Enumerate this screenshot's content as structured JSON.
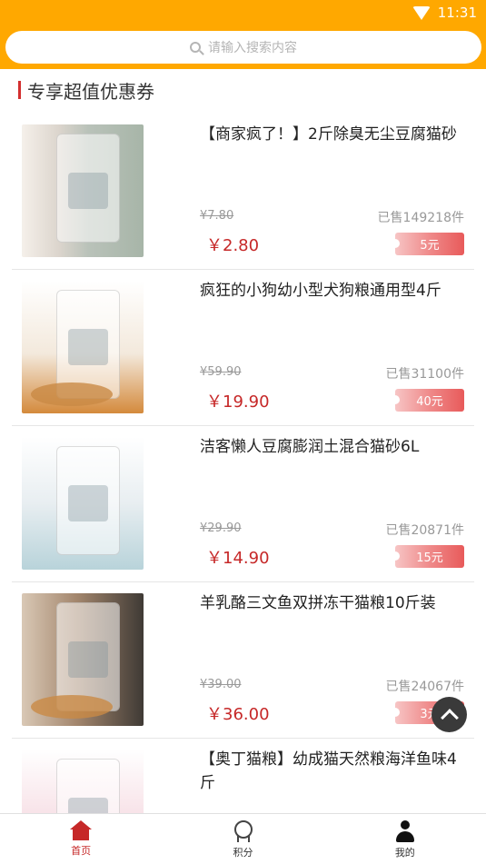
{
  "status_bar": {
    "time": "11:31"
  },
  "search": {
    "placeholder": "请输入搜索内容"
  },
  "section": {
    "title": "专享超值优惠券"
  },
  "products": [
    {
      "name": "【商家疯了！】2斤除臭无尘豆腐猫砂",
      "original_price": "¥7.80",
      "sold": "已售149218件",
      "price": "￥2.80",
      "coupon": "5元"
    },
    {
      "name": "疯狂的小狗幼小型犬狗粮通用型4斤",
      "original_price": "¥59.90",
      "sold": "已售31100件",
      "price": "￥19.90",
      "coupon": "40元"
    },
    {
      "name": "洁客懒人豆腐膨润土混合猫砂6L",
      "original_price": "¥29.90",
      "sold": "已售20871件",
      "price": "￥14.90",
      "coupon": "15元"
    },
    {
      "name": "羊乳酪三文鱼双拼冻干猫粮10斤装",
      "original_price": "¥39.00",
      "sold": "已售24067件",
      "price": "￥36.00",
      "coupon": "3元"
    },
    {
      "name": "【奥丁猫粮】幼成猫天然粮海洋鱼味4斤",
      "original_price": "",
      "sold": "",
      "price": "",
      "coupon": ""
    }
  ],
  "tabbar": {
    "home": "首页",
    "points": "积分",
    "mine": "我的"
  },
  "colors": {
    "header": "#ffa800",
    "accent": "#c62828",
    "coupon_start": "#f7c5c5",
    "coupon_end": "#e85a5a"
  },
  "icons": {
    "search": "search-icon",
    "wifi": "wifi-icon",
    "home": "home-icon",
    "points": "medal-icon",
    "mine": "user-icon",
    "scroll_top": "chevron-up-icon"
  }
}
